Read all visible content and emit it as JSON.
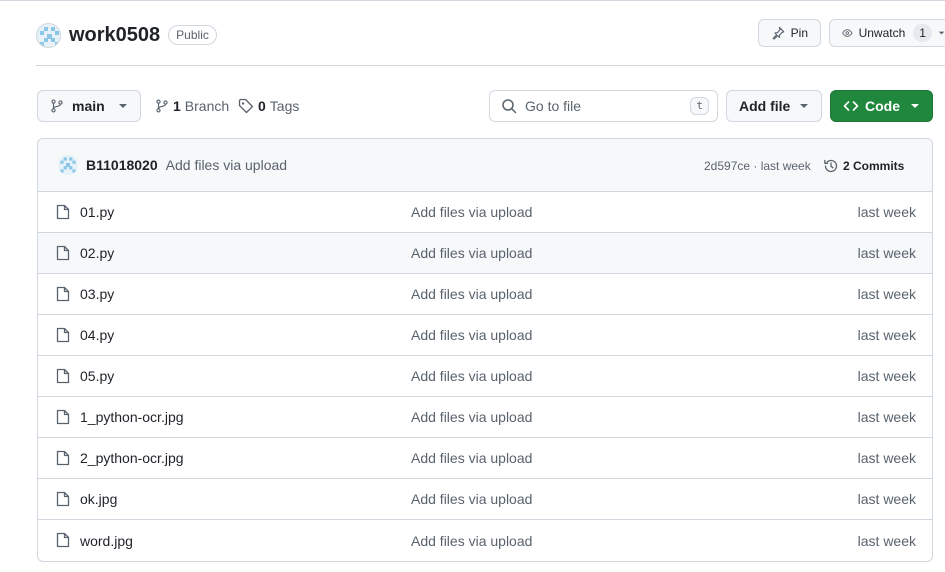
{
  "repo": {
    "name": "work0508",
    "visibility": "Public"
  },
  "header_actions": {
    "pin_label": "Pin",
    "unwatch_label": "Unwatch",
    "watch_count": "1"
  },
  "toolbar": {
    "branch_name": "main",
    "branch_count": "1",
    "branch_word": "Branch",
    "tag_count": "0",
    "tag_word": "Tags",
    "goto_placeholder": "Go to file",
    "goto_shortcut": "t",
    "add_file_label": "Add file",
    "code_label": "Code"
  },
  "commit": {
    "author": "B11018020",
    "message": "Add files via upload",
    "meta": "2d597ce · last week",
    "commits_label": "2 Commits"
  },
  "files": [
    {
      "name": "01.py",
      "message": "Add files via upload",
      "date": "last week"
    },
    {
      "name": "02.py",
      "message": "Add files via upload",
      "date": "last week"
    },
    {
      "name": "03.py",
      "message": "Add files via upload",
      "date": "last week"
    },
    {
      "name": "04.py",
      "message": "Add files via upload",
      "date": "last week"
    },
    {
      "name": "05.py",
      "message": "Add files via upload",
      "date": "last week"
    },
    {
      "name": "1_python-ocr.jpg",
      "message": "Add files via upload",
      "date": "last week"
    },
    {
      "name": "2_python-ocr.jpg",
      "message": "Add files via upload",
      "date": "last week"
    },
    {
      "name": "ok.jpg",
      "message": "Add files via upload",
      "date": "last week"
    },
    {
      "name": "word.jpg",
      "message": "Add files via upload",
      "date": "last week"
    }
  ],
  "colors": {
    "accent_green": "#1f883d",
    "border": "#d0d7de",
    "muted_text": "#59636e",
    "row_hover": "#f6f8fa"
  },
  "icons": [
    "repo-avatar-identicon",
    "pin-icon",
    "eye-icon",
    "branch-icon",
    "tag-icon",
    "search-icon",
    "code-icon",
    "history-icon",
    "file-icon",
    "triangle-down-icon"
  ]
}
